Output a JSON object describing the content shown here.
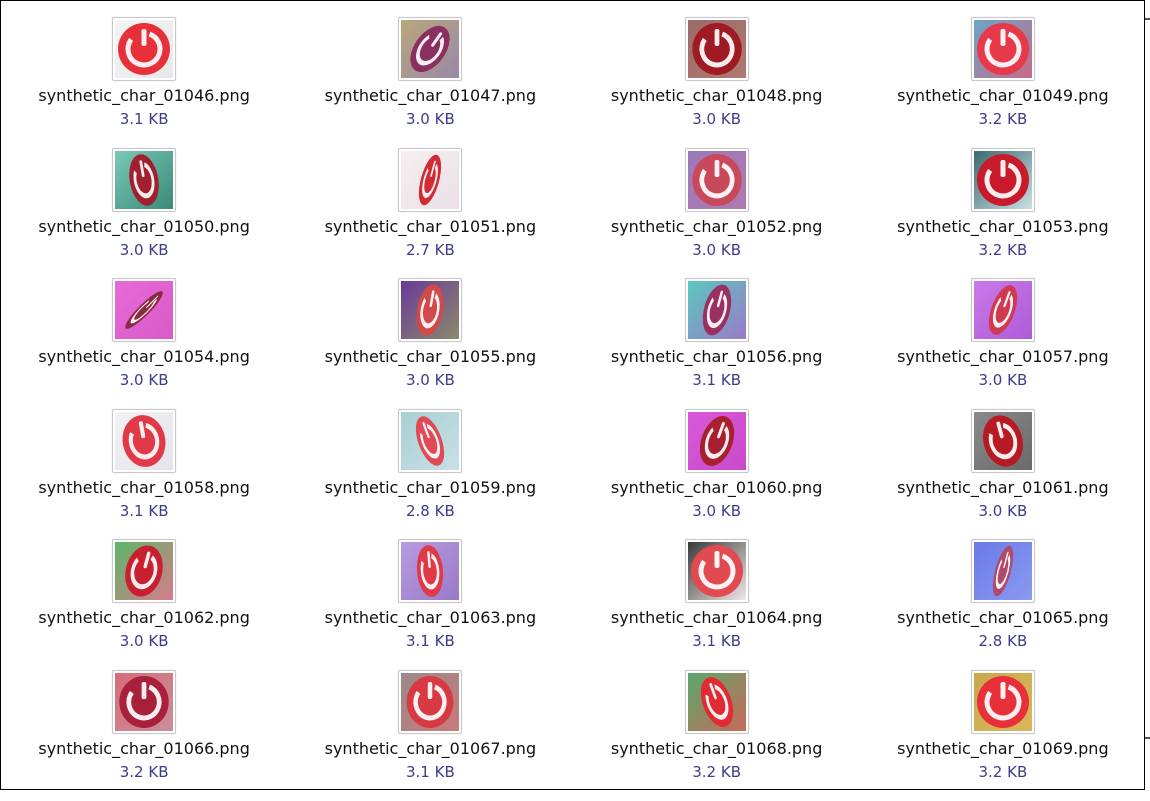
{
  "files": [
    {
      "name": "synthetic_char_01046.png",
      "size": "3.1 KB",
      "icon": "power-symbol-icon",
      "bg": [
        "#f4f4f4",
        "#e8e8e8"
      ],
      "sign": "#e8303a",
      "rot": 0,
      "sx": 1.0
    },
    {
      "name": "synthetic_char_01047.png",
      "size": "3.0 KB",
      "icon": "power-symbol-icon",
      "bg": [
        "#b8a87a",
        "#9a88a8"
      ],
      "sign": "#8a3060",
      "rot": 35,
      "sx": 0.6
    },
    {
      "name": "synthetic_char_01048.png",
      "size": "3.0 KB",
      "icon": "power-symbol-icon",
      "bg": [
        "#9a6a6a",
        "#b07a72"
      ],
      "sign": "#a01a24",
      "rot": 0,
      "sx": 0.95
    },
    {
      "name": "synthetic_char_01049.png",
      "size": "3.2 KB",
      "icon": "power-symbol-icon",
      "bg": [
        "#6aa6c8",
        "#c86a88"
      ],
      "sign": "#e63a4a",
      "rot": 0,
      "sx": 1.0
    },
    {
      "name": "synthetic_char_01050.png",
      "size": "3.0 KB",
      "icon": "power-symbol-icon",
      "bg": [
        "#7ac8b8",
        "#3a8a78"
      ],
      "sign": "#a02030",
      "rot": -10,
      "sx": 0.55
    },
    {
      "name": "synthetic_char_01051.png",
      "size": "2.7 KB",
      "icon": "power-symbol-icon",
      "bg": [
        "#f6eef0",
        "#eae0e6"
      ],
      "sign": "#d02c36",
      "rot": 15,
      "sx": 0.35
    },
    {
      "name": "synthetic_char_01052.png",
      "size": "3.0 KB",
      "icon": "power-symbol-icon",
      "bg": [
        "#9a7ab8",
        "#b07ab0"
      ],
      "sign": "#c84a5a",
      "rot": 0,
      "sx": 0.95
    },
    {
      "name": "synthetic_char_01053.png",
      "size": "3.2 KB",
      "icon": "power-symbol-icon",
      "bg": [
        "#3a6a70",
        "#c8e0e4"
      ],
      "sign": "#c81a2a",
      "rot": 0,
      "sx": 1.0
    },
    {
      "name": "synthetic_char_01054.png",
      "size": "3.0 KB",
      "icon": "power-symbol-icon",
      "bg": [
        "#e86ad8",
        "#d85ac8"
      ],
      "sign": "#8a2a44",
      "rot": 45,
      "sx": 0.22
    },
    {
      "name": "synthetic_char_01055.png",
      "size": "3.0 KB",
      "icon": "power-symbol-icon",
      "bg": [
        "#6a3a9a",
        "#8a8a6a"
      ],
      "sign": "#d04a4a",
      "rot": 10,
      "sx": 0.5
    },
    {
      "name": "synthetic_char_01056.png",
      "size": "3.1 KB",
      "icon": "power-symbol-icon",
      "bg": [
        "#5ac8c0",
        "#9a7ac8"
      ],
      "sign": "#9a3060",
      "rot": 15,
      "sx": 0.5
    },
    {
      "name": "synthetic_char_01057.png",
      "size": "3.0 KB",
      "icon": "power-symbol-icon",
      "bg": [
        "#c87ae8",
        "#b05ad8"
      ],
      "sign": "#d03a50",
      "rot": 20,
      "sx": 0.45
    },
    {
      "name": "synthetic_char_01058.png",
      "size": "3.1 KB",
      "icon": "power-symbol-icon",
      "bg": [
        "#f2f2f4",
        "#e4e4ea"
      ],
      "sign": "#e03a48",
      "rot": -10,
      "sx": 0.82
    },
    {
      "name": "synthetic_char_01059.png",
      "size": "2.8 KB",
      "icon": "power-symbol-icon",
      "bg": [
        "#a8d0d4",
        "#c8e0e6"
      ],
      "sign": "#e04a54",
      "rot": -20,
      "sx": 0.45
    },
    {
      "name": "synthetic_char_01060.png",
      "size": "3.0 KB",
      "icon": "power-symbol-icon",
      "bg": [
        "#d85ad8",
        "#c84ac8"
      ],
      "sign": "#a82030",
      "rot": 20,
      "sx": 0.6
    },
    {
      "name": "synthetic_char_01061.png",
      "size": "3.0 KB",
      "icon": "power-symbol-icon",
      "bg": [
        "#8a8a8a",
        "#6a6a6a"
      ],
      "sign": "#b81a24",
      "rot": -15,
      "sx": 0.75
    },
    {
      "name": "synthetic_char_01062.png",
      "size": "3.0 KB",
      "icon": "power-symbol-icon",
      "bg": [
        "#5ab86a",
        "#d87a8a"
      ],
      "sign": "#c82030",
      "rot": 15,
      "sx": 0.7
    },
    {
      "name": "synthetic_char_01063.png",
      "size": "3.1 KB",
      "icon": "power-symbol-icon",
      "bg": [
        "#b89ae0",
        "#9a7ac8"
      ],
      "sign": "#e03a48",
      "rot": -5,
      "sx": 0.5
    },
    {
      "name": "synthetic_char_01064.png",
      "size": "3.1 KB",
      "icon": "power-symbol-icon",
      "bg": [
        "#3a3a3a",
        "#f0e8e8"
      ],
      "sign": "#e04a50",
      "rot": 0,
      "sx": 1.0
    },
    {
      "name": "synthetic_char_01065.png",
      "size": "2.8 KB",
      "icon": "power-symbol-icon",
      "bg": [
        "#6a7ae8",
        "#8a9af0"
      ],
      "sign": "#b04a6a",
      "rot": 15,
      "sx": 0.3
    },
    {
      "name": "synthetic_char_01066.png",
      "size": "3.2 KB",
      "icon": "power-symbol-icon",
      "bg": [
        "#d86a7a",
        "#c8909a"
      ],
      "sign": "#a8203a",
      "rot": 0,
      "sx": 0.95
    },
    {
      "name": "synthetic_char_01067.png",
      "size": "3.1 KB",
      "icon": "power-symbol-icon",
      "bg": [
        "#9a8a8a",
        "#c87a7a"
      ],
      "sign": "#d83a44",
      "rot": 0,
      "sx": 0.9
    },
    {
      "name": "synthetic_char_01068.png",
      "size": "3.2 KB",
      "icon": "power-symbol-icon",
      "bg": [
        "#5aa86a",
        "#c86a5a"
      ],
      "sign": "#e02a34",
      "rot": -20,
      "sx": 0.55
    },
    {
      "name": "synthetic_char_01069.png",
      "size": "3.2 KB",
      "icon": "power-symbol-icon",
      "bg": [
        "#c8a84a",
        "#d8b85a"
      ],
      "sign": "#e8303a",
      "rot": 0,
      "sx": 1.0
    }
  ]
}
